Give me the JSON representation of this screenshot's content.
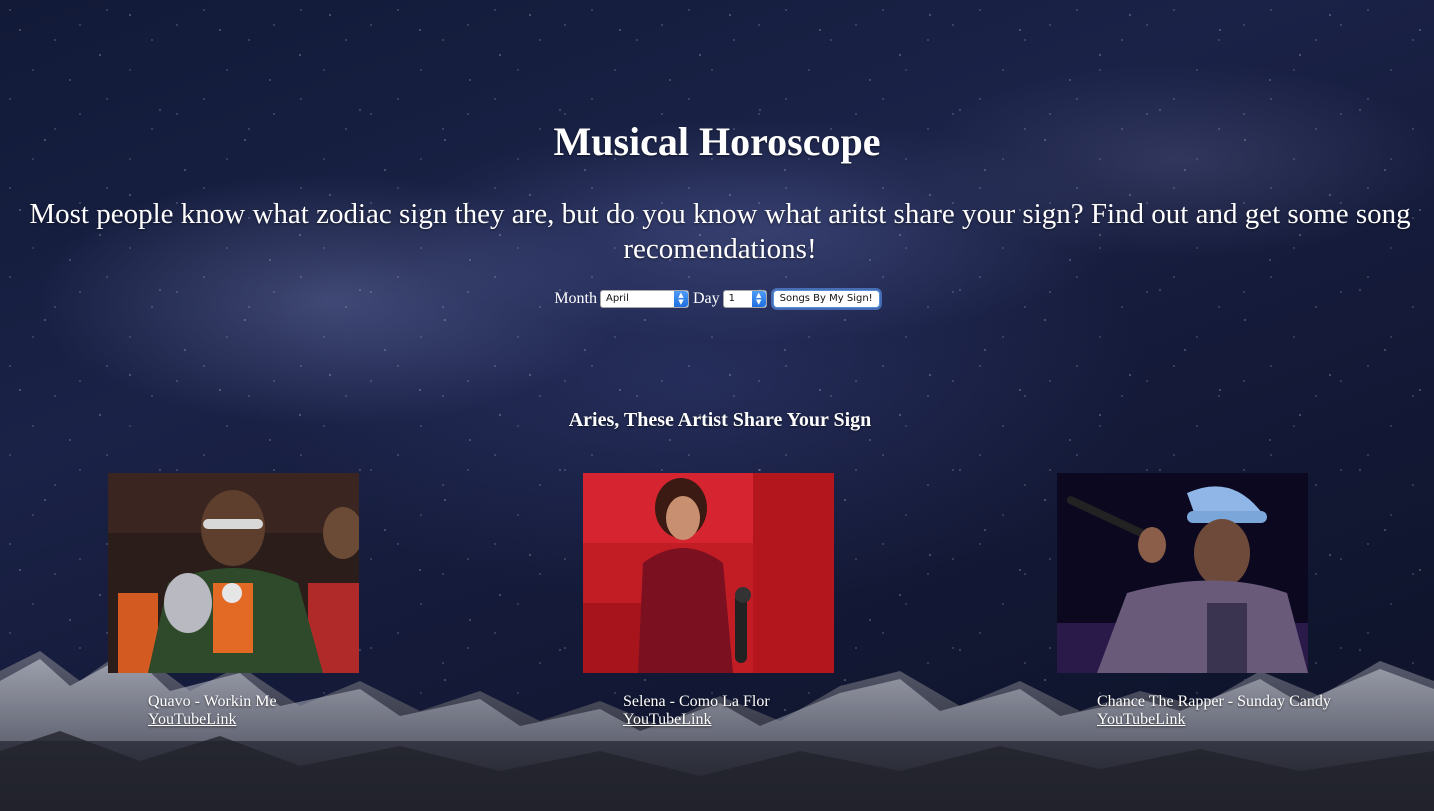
{
  "page": {
    "title": "Musical Horoscope",
    "intro": "Most people know what zodiac sign they are, but do you know what aritst share your sign? Find out and get some song recomendations!"
  },
  "form": {
    "month_label": "Month",
    "month_value": "April",
    "day_label": "Day",
    "day_value": "1",
    "submit_label": "Songs By My Sign!"
  },
  "results": {
    "heading": "Aries, These Artist Share Your Sign",
    "cards": [
      {
        "caption": "Quavo - Workin Me",
        "link_label": "YouTubeLink",
        "photo": "artist-photo-quavo"
      },
      {
        "caption": "Selena - Como La Flor",
        "link_label": "YouTubeLink",
        "photo": "artist-photo-selena"
      },
      {
        "caption": "Chance The Rapper - Sunday Candy",
        "link_label": "YouTubeLink",
        "photo": "artist-photo-chance"
      }
    ]
  },
  "colors": {
    "text": "#ffffff",
    "select_accent": "#1f6fe0",
    "sky": "#141a38"
  }
}
